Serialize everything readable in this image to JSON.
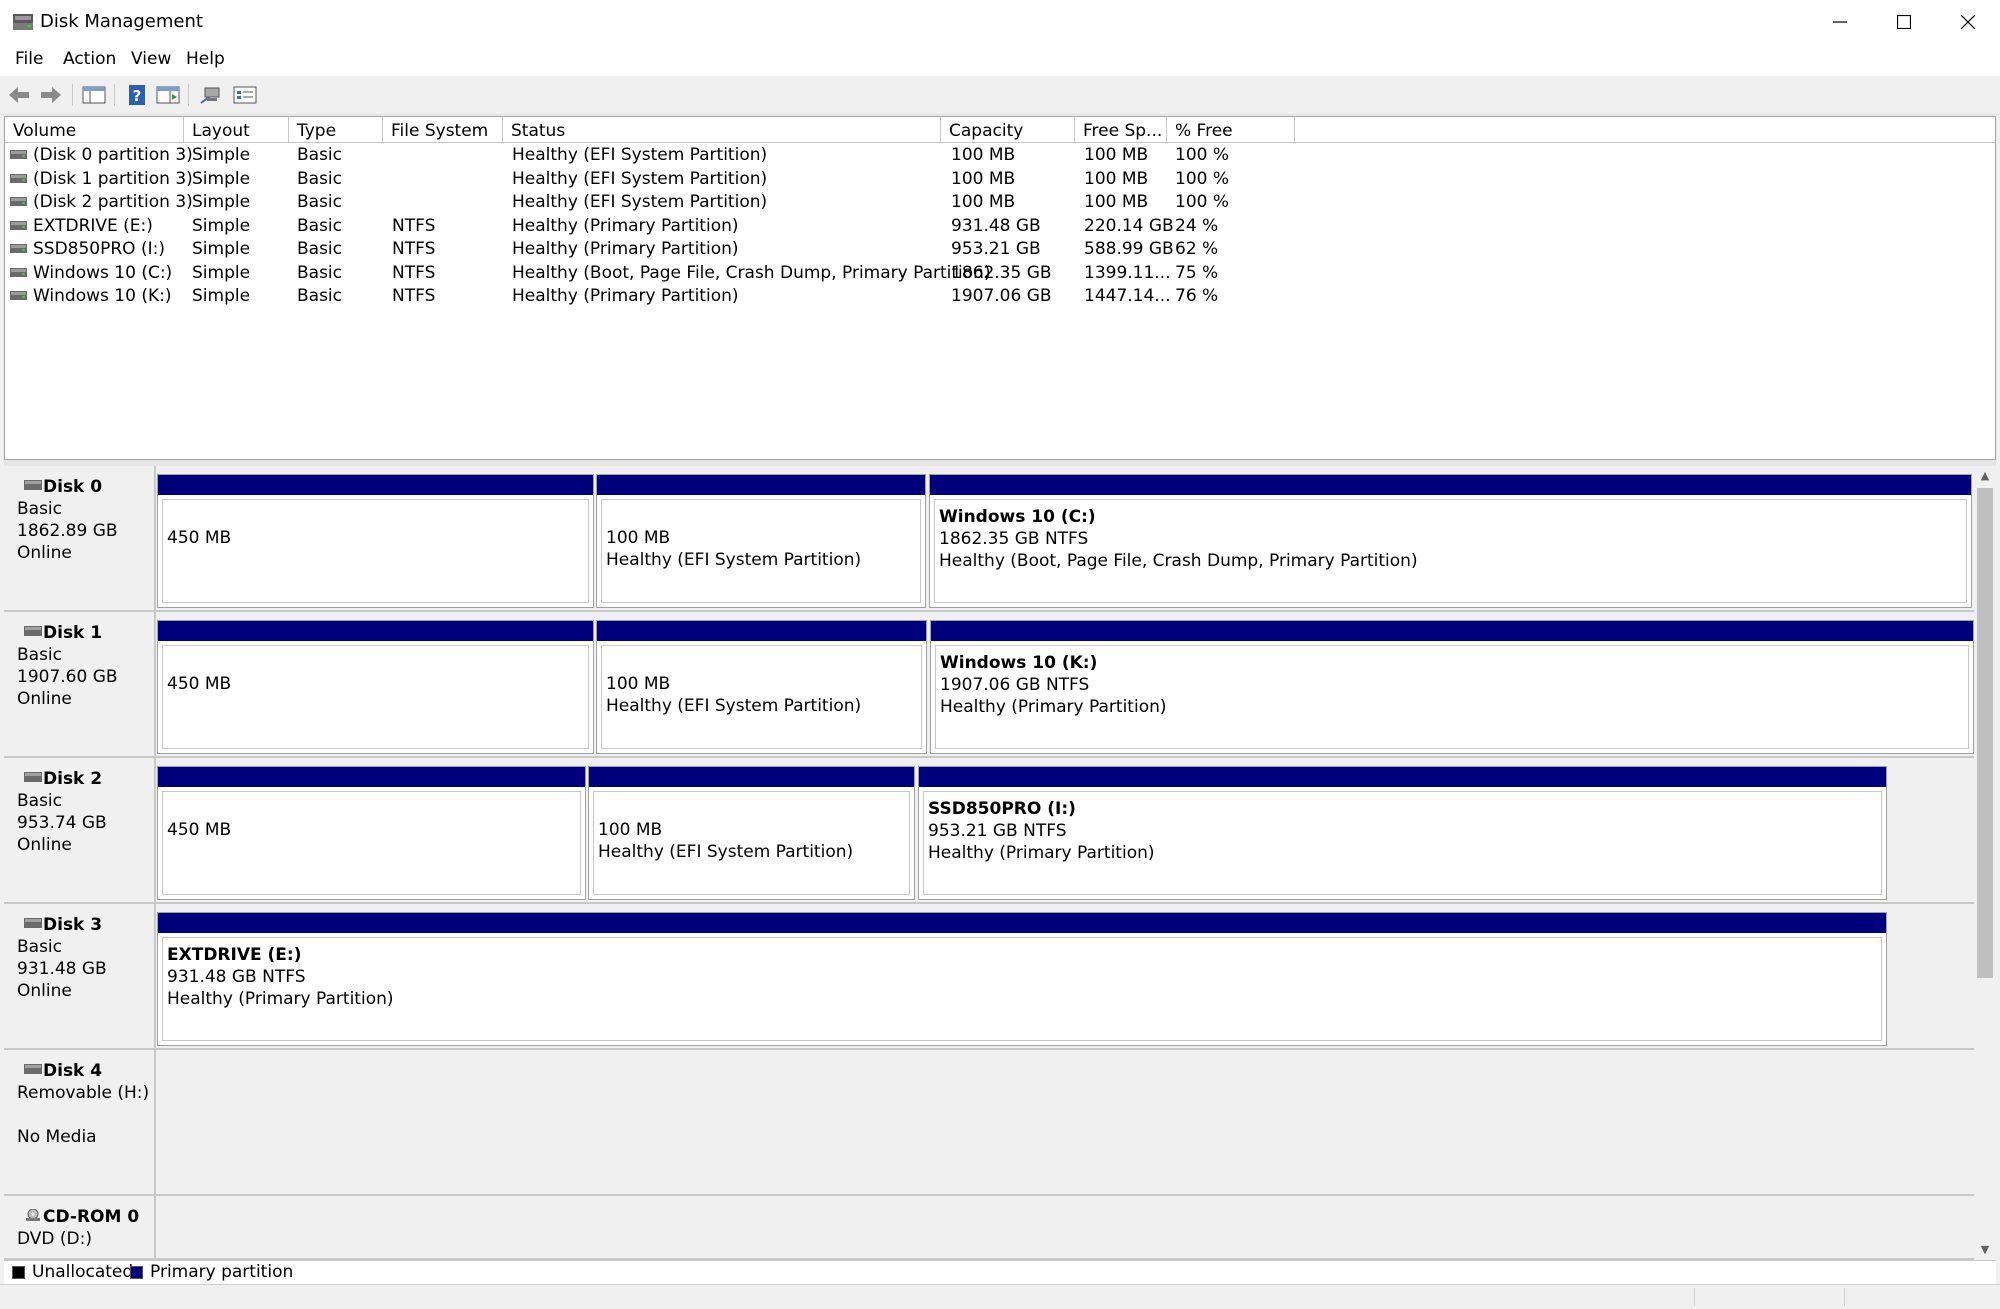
{
  "window": {
    "title": "Disk Management"
  },
  "menu": [
    "File",
    "Action",
    "View",
    "Help"
  ],
  "toolbar": [
    "back-icon",
    "forward-icon",
    "show-hide-console-tree-icon",
    "help-icon",
    "properties-icon",
    "connect-icon",
    "show-description-icon"
  ],
  "volume_list": {
    "columns": [
      "Volume",
      "Layout",
      "Type",
      "File System",
      "Status",
      "Capacity",
      "Free Sp...",
      "% Free"
    ],
    "rows": [
      [
        "(Disk 0 partition 3)",
        "Simple",
        "Basic",
        "",
        "Healthy (EFI System Partition)",
        "100 MB",
        "100 MB",
        "100 %"
      ],
      [
        "(Disk 1 partition 3)",
        "Simple",
        "Basic",
        "",
        "Healthy (EFI System Partition)",
        "100 MB",
        "100 MB",
        "100 %"
      ],
      [
        "(Disk 2 partition 3)",
        "Simple",
        "Basic",
        "",
        "Healthy (EFI System Partition)",
        "100 MB",
        "100 MB",
        "100 %"
      ],
      [
        "EXTDRIVE (E:)",
        "Simple",
        "Basic",
        "NTFS",
        "Healthy (Primary Partition)",
        "931.48 GB",
        "220.14 GB",
        "24 %"
      ],
      [
        "SSD850PRO (I:)",
        "Simple",
        "Basic",
        "NTFS",
        "Healthy (Primary Partition)",
        "953.21 GB",
        "588.99 GB",
        "62 %"
      ],
      [
        "Windows 10 (C:)",
        "Simple",
        "Basic",
        "NTFS",
        "Healthy (Boot, Page File, Crash Dump, Primary Partition)",
        "1862.35 GB",
        "1399.11...",
        "75 %"
      ],
      [
        "Windows 10 (K:)",
        "Simple",
        "Basic",
        "NTFS",
        "Healthy (Primary Partition)",
        "1907.06 GB",
        "1447.14...",
        "76 %"
      ]
    ]
  },
  "disks": [
    {
      "name": "Disk 0",
      "type": "Basic",
      "size": "1862.89 GB",
      "status": "Online",
      "partitions": [
        {
          "title": "",
          "line1": "450 MB",
          "line2": ""
        },
        {
          "title": "",
          "line1": "100 MB",
          "line2": "Healthy (EFI System Partition)"
        },
        {
          "title": "Windows 10  (C:)",
          "line1": "1862.35 GB NTFS",
          "line2": "Healthy (Boot, Page File, Crash Dump, Primary Partition)"
        }
      ]
    },
    {
      "name": "Disk 1",
      "type": "Basic",
      "size": "1907.60 GB",
      "status": "Online",
      "partitions": [
        {
          "title": "",
          "line1": "450 MB",
          "line2": ""
        },
        {
          "title": "",
          "line1": "100 MB",
          "line2": "Healthy (EFI System Partition)"
        },
        {
          "title": "Windows 10  (K:)",
          "line1": "1907.06 GB NTFS",
          "line2": "Healthy (Primary Partition)"
        }
      ]
    },
    {
      "name": "Disk 2",
      "type": "Basic",
      "size": "953.74 GB",
      "status": "Online",
      "partitions": [
        {
          "title": "",
          "line1": "450 MB",
          "line2": ""
        },
        {
          "title": "",
          "line1": "100 MB",
          "line2": "Healthy (EFI System Partition)"
        },
        {
          "title": "SSD850PRO  (I:)",
          "line1": "953.21 GB NTFS",
          "line2": "Healthy (Primary Partition)"
        }
      ]
    },
    {
      "name": "Disk 3",
      "type": "Basic",
      "size": "931.48 GB",
      "status": "Online",
      "partitions": [
        {
          "title": "EXTDRIVE  (E:)",
          "line1": "931.48 GB NTFS",
          "line2": "Healthy (Primary Partition)"
        }
      ]
    },
    {
      "name": "Disk 4",
      "type": "Removable (H:)",
      "size": "",
      "status": "No Media",
      "partitions": []
    },
    {
      "name": "CD-ROM 0",
      "type": "DVD (D:)",
      "size": "",
      "status": "",
      "partitions": []
    }
  ],
  "legend": [
    {
      "label": "Unallocated",
      "color": "#000000"
    },
    {
      "label": "Primary partition",
      "color": "#00007f"
    }
  ]
}
